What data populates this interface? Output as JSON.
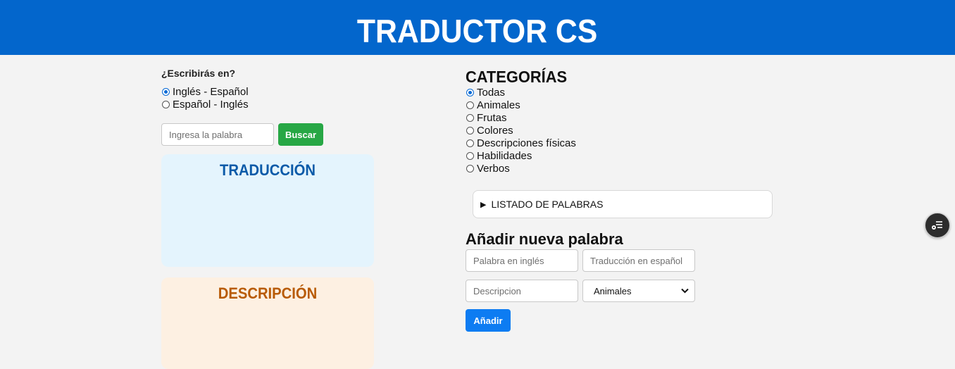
{
  "header": {
    "title": "TRADUCTOR CS"
  },
  "direction": {
    "question": "¿Escribirás en?",
    "options": [
      {
        "label": "Inglés - Español",
        "checked": true
      },
      {
        "label": "Español - Inglés",
        "checked": false
      }
    ]
  },
  "search": {
    "placeholder": "Ingresa la palabra",
    "button": "Buscar"
  },
  "panels": {
    "translation_title": "TRADUCCIÓN",
    "description_title": "DESCRIPCIÓN"
  },
  "categories": {
    "title": "CATEGORÍAS",
    "options": [
      {
        "label": "Todas",
        "checked": true
      },
      {
        "label": "Animales",
        "checked": false
      },
      {
        "label": "Frutas",
        "checked": false
      },
      {
        "label": "Colores",
        "checked": false
      },
      {
        "label": "Descripciones físicas",
        "checked": false
      },
      {
        "label": "Habilidades",
        "checked": false
      },
      {
        "label": "Verbos",
        "checked": false
      }
    ]
  },
  "word_list": {
    "label": "LISTADO DE PALABRAS"
  },
  "add_word": {
    "title": "Añadir nueva palabra",
    "english_placeholder": "Palabra en inglés",
    "spanish_placeholder": "Traducción en español",
    "description_placeholder": "Descripcion",
    "category_selected": "Animales",
    "button": "Añadir"
  },
  "colors": {
    "header": "#0366cc",
    "search_button": "#27a745",
    "add_button": "#0d7cf2",
    "translation_panel": "#e4f4fd",
    "description_panel": "#fdf0e2"
  },
  "icons": {
    "floating": "list-settings-icon",
    "disclosure": "triangle-right-icon",
    "select": "chevron-down-icon"
  }
}
